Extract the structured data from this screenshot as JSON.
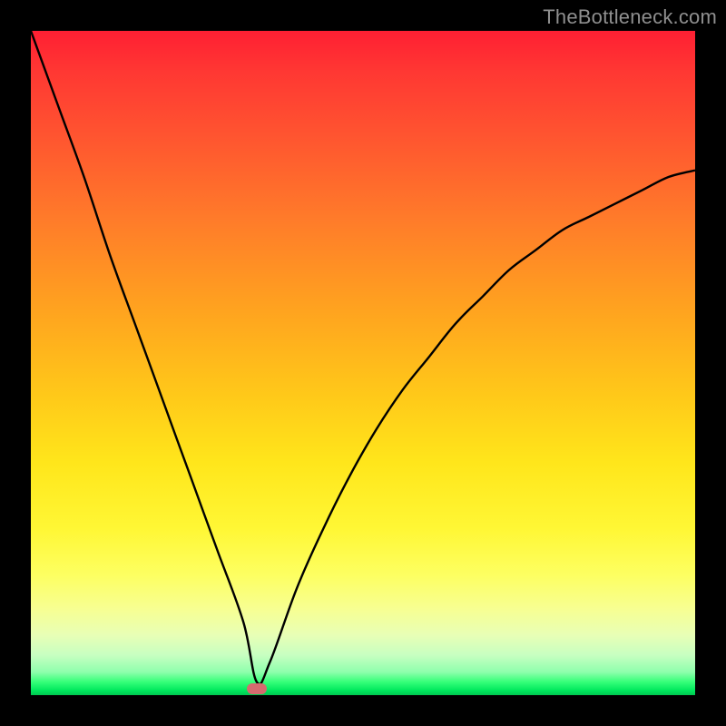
{
  "watermark": "TheBottleneck.com",
  "colors": {
    "frame": "#000000",
    "curve": "#000000",
    "marker": "#d66b6f"
  },
  "chart_data": {
    "type": "line",
    "title": "",
    "xlabel": "",
    "ylabel": "",
    "xlim": [
      0,
      100
    ],
    "ylim": [
      0,
      100
    ],
    "grid": false,
    "legend": false,
    "series": [
      {
        "name": "bottleneck-curve",
        "x": [
          0,
          4,
          8,
          12,
          16,
          20,
          24,
          28,
          32,
          34,
          36,
          40,
          44,
          48,
          52,
          56,
          60,
          64,
          68,
          72,
          76,
          80,
          84,
          88,
          92,
          96,
          100
        ],
        "y": [
          100,
          89,
          78,
          66,
          55,
          44,
          33,
          22,
          11,
          2,
          5,
          16,
          25,
          33,
          40,
          46,
          51,
          56,
          60,
          64,
          67,
          70,
          72,
          74,
          76,
          78,
          79
        ]
      }
    ],
    "annotations": [
      {
        "name": "minimum-marker",
        "x": 34,
        "y": 1
      }
    ]
  }
}
